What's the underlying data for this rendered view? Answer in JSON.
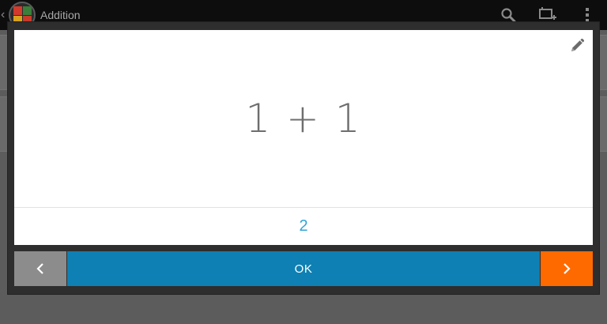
{
  "actionbar": {
    "title": "Addition",
    "icons": [
      "search-icon",
      "add-card-icon",
      "overflow-menu-icon"
    ]
  },
  "card": {
    "question": "1 + 1",
    "answer": "2",
    "edit_icon": "pencil-icon"
  },
  "buttons": {
    "prev_icon": "chevron-left-icon",
    "ok_label": "OK",
    "next_icon": "chevron-right-icon"
  },
  "colors": {
    "answer": "#33a3d6",
    "ok_button": "#0e80b3",
    "next_button": "#ff6a00",
    "prev_button": "#8c8c8c"
  }
}
